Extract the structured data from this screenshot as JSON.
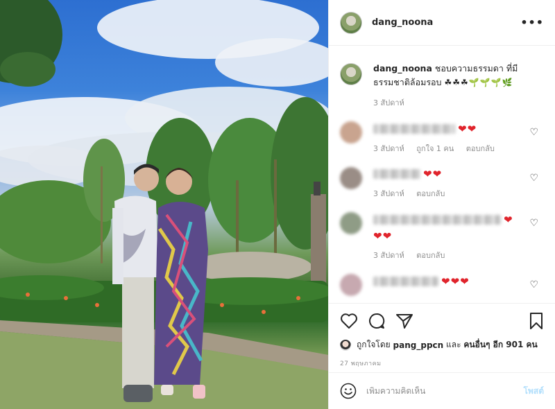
{
  "header": {
    "username": "dang_noona",
    "more_label": "•••"
  },
  "caption": {
    "username": "dang_noona",
    "text": "ชอบความธรรมดา ที่มีธรรมชาติล้อมรอบ",
    "emoji": "☘☘☘🌱🌱🌱🌿",
    "time": "3 สัปดาห์"
  },
  "comments": [
    {
      "hearts": "❤❤",
      "time": "3 สัปดาห์",
      "likes": "ถูกใจ 1 คน",
      "reply": "ตอบกลับ",
      "avatar_color": "#c9a48f"
    },
    {
      "hearts": "❤❤",
      "time": "3 สัปดาห์",
      "likes": "",
      "reply": "ตอบกลับ",
      "avatar_color": "#9a8d86"
    },
    {
      "hearts": "❤",
      "hearts2": "❤❤",
      "time": "3 สัปดาห์",
      "likes": "",
      "reply": "ตอบกลับ",
      "avatar_color": "#8f9c86"
    },
    {
      "hearts": "❤❤❤",
      "time": "",
      "likes": "",
      "reply": "",
      "avatar_color": "#c7a9b0"
    }
  ],
  "likes": {
    "prefix": "ถูกใจโดย",
    "user": "pang_ppcn",
    "middle": "และ",
    "others": "คนอื่นๆ อีก 901 คน"
  },
  "date": "27 พฤษภาคม",
  "add_comment": {
    "placeholder": "เพิ่มความคิดเห็น",
    "post_label": "โพสต์"
  },
  "icons": {
    "like": "heart-icon",
    "comment": "comment-bubble-icon",
    "share": "paper-plane-icon",
    "save": "bookmark-icon",
    "emoji": "smiley-icon"
  },
  "colors": {
    "heart_red": "#e0242c",
    "post_button": "#b2dffc",
    "meta_gray": "#8e8e8e"
  }
}
